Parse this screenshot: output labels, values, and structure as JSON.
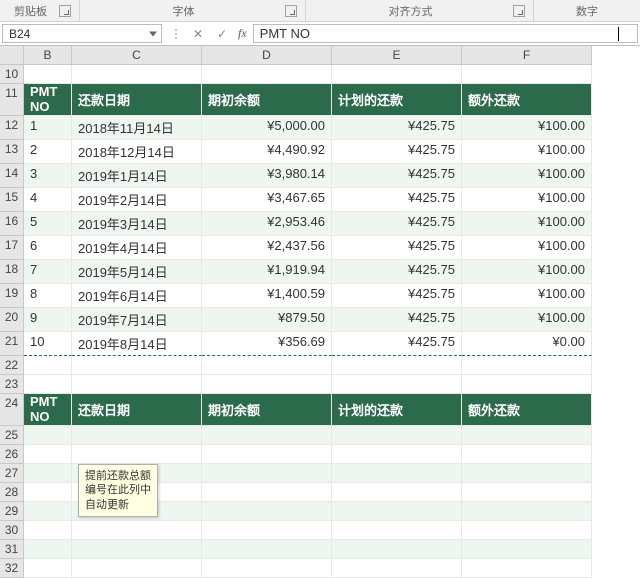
{
  "ribbon": {
    "group1": "剪贴板",
    "group2": "字体",
    "group3": "对齐方式",
    "group4": "数字"
  },
  "formula_bar": {
    "name_box": "B24",
    "cancel_icon": "✕",
    "enter_icon": "✓",
    "fx_label": "fx",
    "value": "PMT NO"
  },
  "columns": [
    "B",
    "C",
    "D",
    "E",
    "F"
  ],
  "row_numbers_top": [
    "10",
    "11",
    "12",
    "13",
    "14",
    "15",
    "16",
    "17",
    "18",
    "19",
    "20",
    "21",
    "22",
    "23"
  ],
  "row_numbers_bottom": [
    "24",
    "25",
    "26",
    "27",
    "28",
    "29",
    "30",
    "31",
    "32"
  ],
  "headers": {
    "pmt_no": "PMT NO",
    "date": "还款日期",
    "begin_bal": "期初余额",
    "sched_pmt": "计划的还款",
    "extra_pmt": "额外还款"
  },
  "rows": [
    {
      "no": "1",
      "date": "2018年11月14日",
      "begin": "¥5,000.00",
      "sched": "¥425.75",
      "extra": "¥100.00"
    },
    {
      "no": "2",
      "date": "2018年12月14日",
      "begin": "¥4,490.92",
      "sched": "¥425.75",
      "extra": "¥100.00"
    },
    {
      "no": "3",
      "date": "2019年1月14日",
      "begin": "¥3,980.14",
      "sched": "¥425.75",
      "extra": "¥100.00"
    },
    {
      "no": "4",
      "date": "2019年2月14日",
      "begin": "¥3,467.65",
      "sched": "¥425.75",
      "extra": "¥100.00"
    },
    {
      "no": "5",
      "date": "2019年3月14日",
      "begin": "¥2,953.46",
      "sched": "¥425.75",
      "extra": "¥100.00"
    },
    {
      "no": "6",
      "date": "2019年4月14日",
      "begin": "¥2,437.56",
      "sched": "¥425.75",
      "extra": "¥100.00"
    },
    {
      "no": "7",
      "date": "2019年5月14日",
      "begin": "¥1,919.94",
      "sched": "¥425.75",
      "extra": "¥100.00"
    },
    {
      "no": "8",
      "date": "2019年6月14日",
      "begin": "¥1,400.59",
      "sched": "¥425.75",
      "extra": "¥100.00"
    },
    {
      "no": "9",
      "date": "2019年7月14日",
      "begin": "¥879.50",
      "sched": "¥425.75",
      "extra": "¥100.00"
    },
    {
      "no": "10",
      "date": "2019年8月14日",
      "begin": "¥356.69",
      "sched": "¥425.75",
      "extra": "¥0.00"
    }
  ],
  "tooltip": "提前还款总额\n编号在此列中\n自动更新"
}
